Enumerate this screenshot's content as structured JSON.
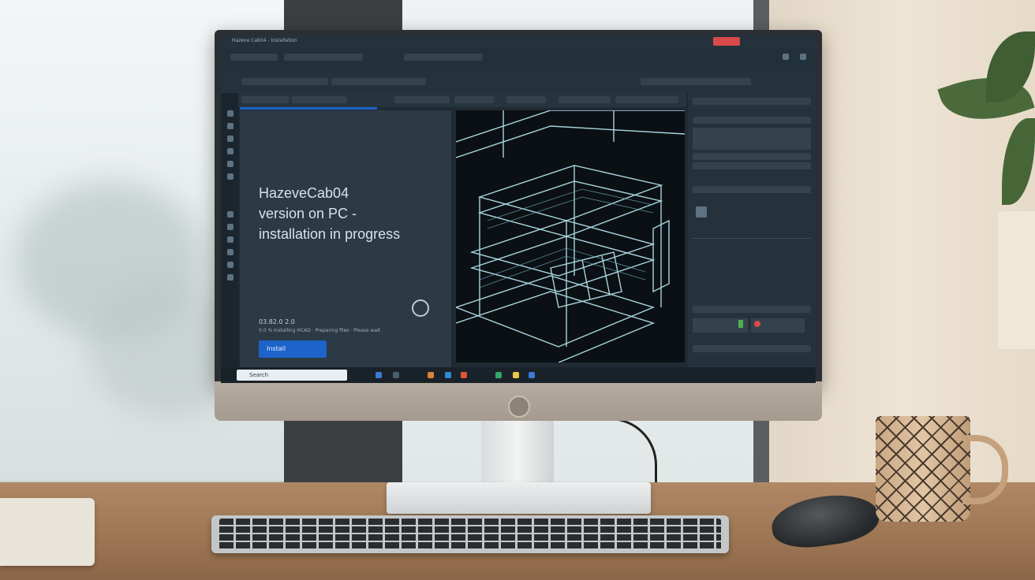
{
  "screen": {
    "window_title": "Hazeve Cab04 - Installation",
    "headline": [
      "HazeveCab04",
      "version on PC -",
      "installation in progress"
    ],
    "version_label": "03.82.0 2.0",
    "status_line": "0.0 % Installing HCAD · Preparing files · Please wait",
    "action_button": "Install",
    "taskbar_search": "Search"
  },
  "colors": {
    "accent_blue": "#1d63c9",
    "close_red": "#d94a4a",
    "wireframe": "#a9d6df",
    "screen_bg": "#1f2a33"
  },
  "icons": [
    "window-close-icon",
    "tool-icon",
    "cube-icon",
    "search-icon",
    "gear-icon",
    "folder-icon",
    "browser-icon"
  ]
}
